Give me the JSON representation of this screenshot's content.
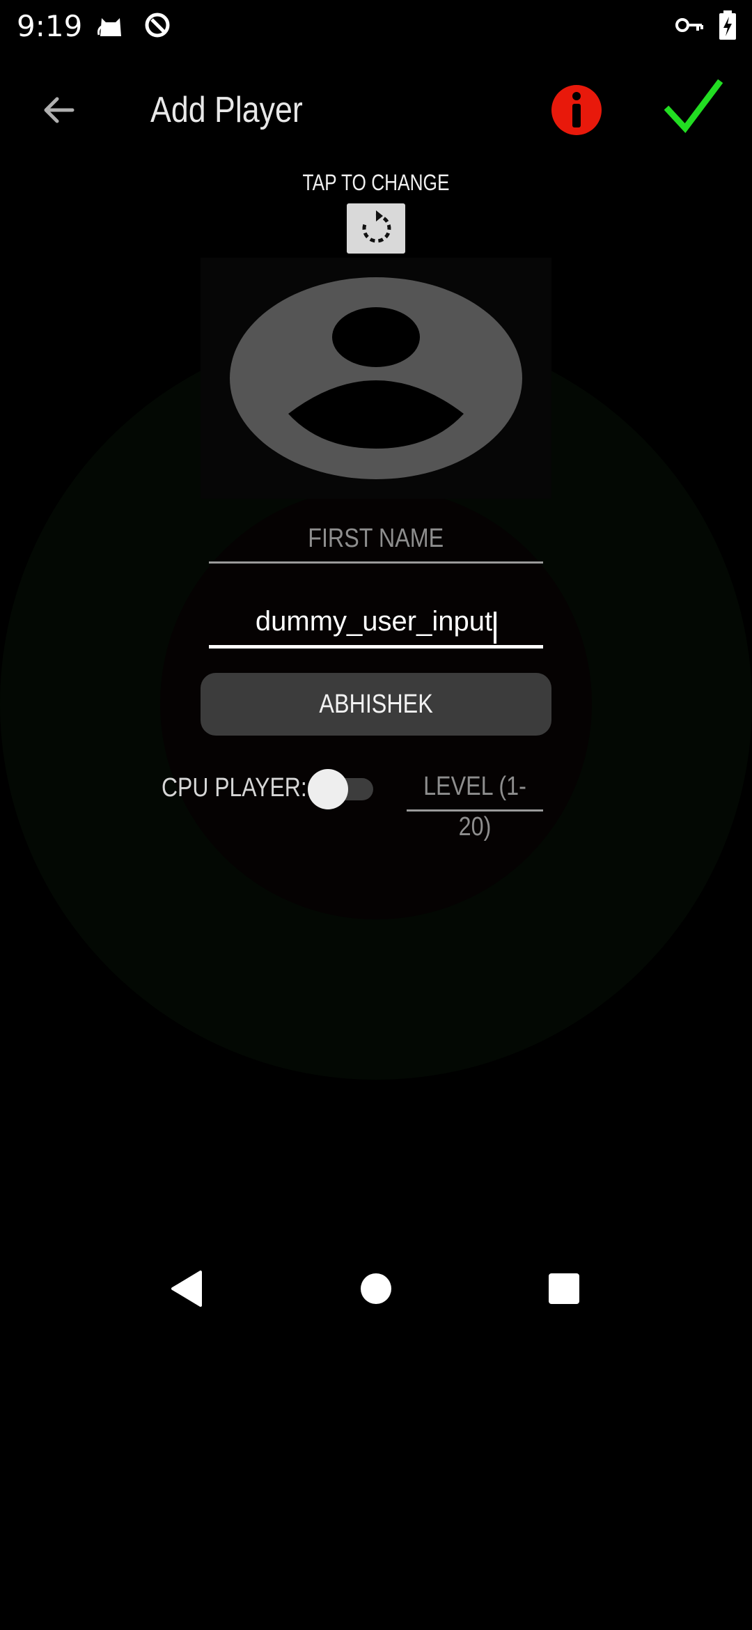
{
  "status_bar": {
    "time": "9:19",
    "icons": [
      "cat-icon",
      "sync-icon",
      "key-icon",
      "battery-icon"
    ]
  },
  "app_bar": {
    "title": "Add Player",
    "back_icon": "arrow-left-icon",
    "info_icon": "info-icon",
    "confirm_icon": "checkmark-icon"
  },
  "avatar_section": {
    "hint": "TAP TO CHANGE",
    "rotate_icon": "rotate-icon"
  },
  "form": {
    "first_name_placeholder": "FIRST NAME",
    "user_input_value": "dummy_user_input",
    "name_button_label": "ABHISHEK",
    "cpu_label": "CPU PLAYER:",
    "cpu_toggle_on": false,
    "level_placeholder": "LEVEL (1-20)"
  },
  "colors": {
    "info": "#e8190b",
    "confirm": "#22dd22",
    "background": "#000000"
  },
  "nav_bar": {
    "icons": [
      "back-triangle-icon",
      "home-circle-icon",
      "recents-square-icon"
    ]
  }
}
